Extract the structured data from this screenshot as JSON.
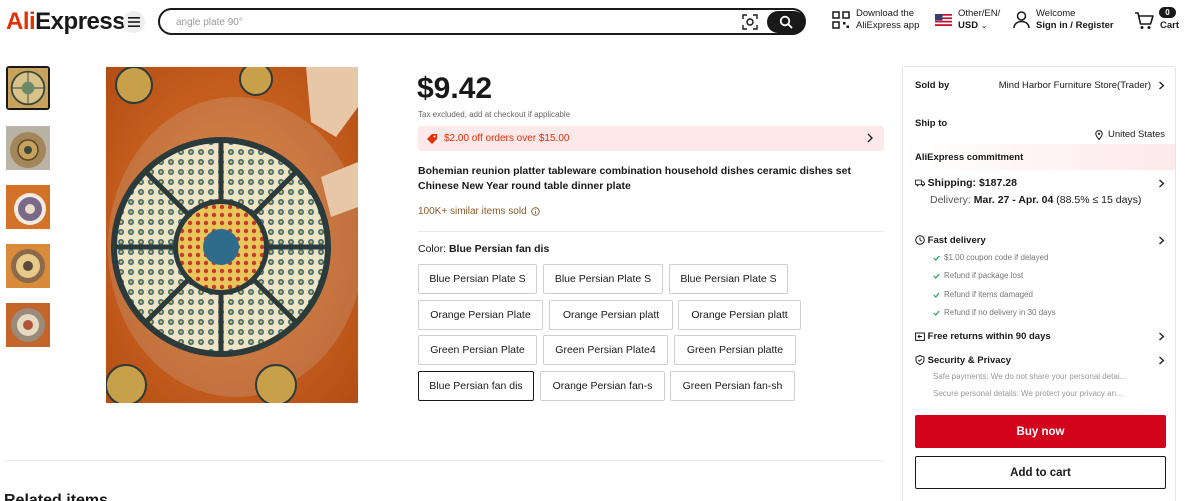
{
  "header": {
    "logo": "AliExpress",
    "search_placeholder": "angle plate 90°",
    "app_line1": "Download the",
    "app_line2": "AliExpress app",
    "locale_line1": "Other/EN/",
    "locale_line2": "USD",
    "account_line1": "Welcome",
    "account_line2": "Sign in / Register",
    "cart_count": "0",
    "cart_label": "Cart"
  },
  "product": {
    "price": "$9.42",
    "tax_note": "Tax excluded, add at checkout if applicable",
    "promo": "$2.00 off orders over $15.00",
    "title": "Bohemian reunion platter tableware combination household dishes ceramic dishes set Chinese New Year round table dinner plate",
    "sold": "100K+ similar items sold",
    "color_label": "Color: ",
    "color_value": "Blue Persian fan dis",
    "options": [
      "Blue Persian Plate S",
      "Blue Persian Plate S",
      "Blue Persian Plate S",
      "Orange Persian Plate",
      "Orange Persian platt",
      "Orange Persian platt",
      "Green Persian Plate",
      "Green Persian Plate4",
      "Green Persian platte",
      "Blue Persian fan dis",
      "Orange Persian fan-s",
      "Green Persian fan-sh"
    ],
    "related_heading": "Related items"
  },
  "panel": {
    "sold_by_label": "Sold by",
    "store": "Mind Harbor Furniture Store(Trader)",
    "ship_to_label": "Ship to",
    "ship_to": "United States",
    "commitment": "AliExpress commitment",
    "shipping_label": "Shipping: $187.28",
    "delivery_prefix": "Delivery: ",
    "delivery_dates": "Mar. 27 - Apr. 04",
    "delivery_suffix": " (88.5% ≤ 15 days)",
    "fast_delivery": "Fast delivery",
    "fast_items": [
      "$1.00 coupon code if delayed",
      "Refund if package lost",
      "Refund if items damaged",
      "Refund if no delivery in 30 days"
    ],
    "free_returns": "Free returns within 90 days",
    "security": "Security & Privacy",
    "security_items": [
      "Safe payments: We do not share your personal detai...",
      "Secure personal details: We protect your privacy an..."
    ],
    "buy_now": "Buy now",
    "add_to_cart": "Add to cart"
  },
  "colors": {
    "accent_red": "#e62e04",
    "buy_button": "#d3031c",
    "promo_bg": "#fde9ea",
    "text": "#191919"
  }
}
